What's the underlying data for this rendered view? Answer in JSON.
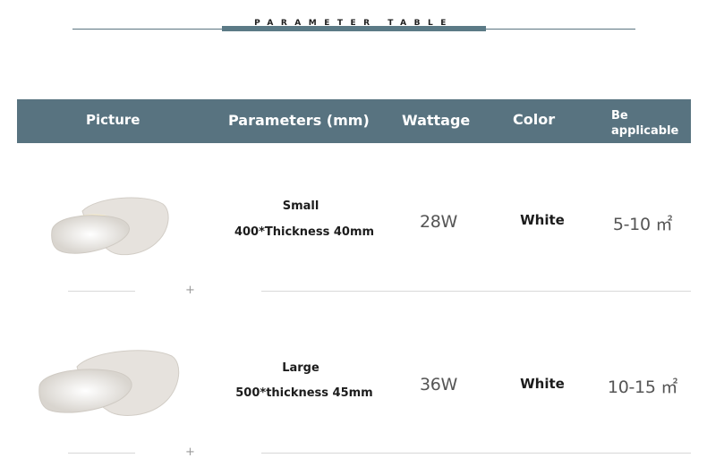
{
  "title": "PARAMETER TABLE",
  "header": {
    "picture": "Picture",
    "parameters": "Parameters (mm)",
    "wattage": "Wattage",
    "color": "Color",
    "applicable": "Be applicable"
  },
  "rows": [
    {
      "size": "Small",
      "dimensions": "400*Thickness 40mm",
      "wattage": "28W",
      "color": "White",
      "area": "5-10 ㎡"
    },
    {
      "size": "Large",
      "dimensions": "500*thickness 45mm",
      "wattage": "36W",
      "color": "White",
      "area": "10-15 ㎡"
    }
  ],
  "colors": {
    "header_bg": "#587380",
    "title_bar": "#5b7a86",
    "lamp_fill": "#e5e2de",
    "glow": "#fff6d6"
  },
  "icons": [
    "lamp-image-small",
    "lamp-image-large",
    "plus-icon"
  ]
}
